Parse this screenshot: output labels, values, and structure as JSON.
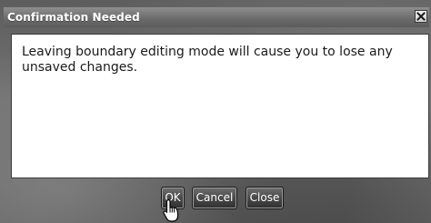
{
  "dialog": {
    "title": "Confirmation Needed",
    "close_icon": "close-icon",
    "message": "Leaving boundary editing mode will cause you to lose any unsaved changes."
  },
  "buttons": {
    "ok": "OK",
    "cancel": "Cancel",
    "close": "Close"
  },
  "cursor_icon": "hand-pointer-icon"
}
